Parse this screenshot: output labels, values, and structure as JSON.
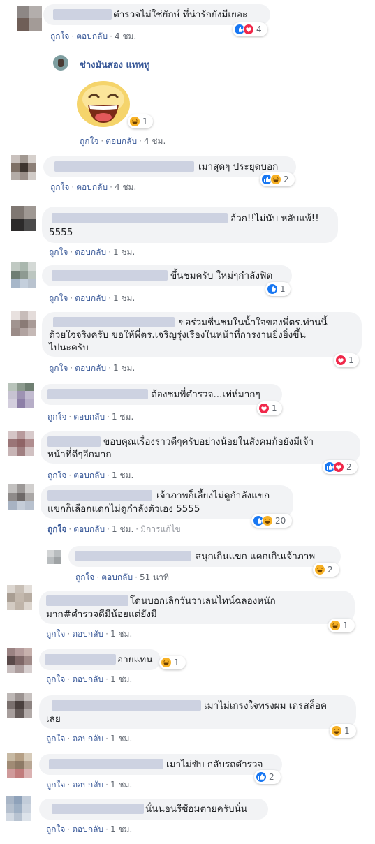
{
  "labels": {
    "like": "ถูกใจ",
    "reply": "ตอบกลับ",
    "edited": "มีการแก้ไข"
  },
  "comments": [
    {
      "text": "ตำรวจไม่ใช่ยักษ์ ที่น่ารักยังมีเยอะ",
      "time": "4 ชม.",
      "count": "4"
    },
    {
      "name": "ช่างมันสอง แทททู",
      "time": "4 ชม.",
      "count": "1"
    },
    {
      "text": "เมาสุดๆ ประยุดบอก",
      "time": "4 ชม.",
      "count": "2"
    },
    {
      "line1": "อ้วก!!ไม่นับ หลับแพ้!!",
      "line2": "5555",
      "time": "1 ชม."
    },
    {
      "text": "ขึ้นชมครับ ใหม่ๆกำลังฟิต",
      "time": "1 ชม.",
      "count": "1"
    },
    {
      "line1": "ขอร่วมชื่นชมในน้ำใจของพี่ตร.ท่านนี้",
      "line2": "ด้วยใจจริงครับ ขอให้พี่ตร.เจริญรุ่งเรืองในหน้าที่การงานยิ่งยิ่งขึ้น",
      "line3": "ไปนะครับ",
      "time": "1 ชม.",
      "count": "1"
    },
    {
      "text": "ต้องชมพี่ตำรวจ...เท่ห์มากๆ",
      "time": "1 ชม.",
      "count": "1"
    },
    {
      "line1": "ขอบคุณเรื่องราวดีๆครับอย่างน้อยในสังคมก้อยังมีเจ้า",
      "line2": "หน้าที่ดีๆอีกมาก",
      "time": "1 ชม.",
      "count": "2"
    },
    {
      "line1": "เจ้าภาพก็เลี้ยงไม่ดูกำลังแขก",
      "line2": "แขกก็เลือกแดกไม่ดูกำลังตัวเอง 5555",
      "time": "1 ชม.",
      "count": "20"
    },
    {
      "text": "สนุกเกินแขก แดกเกินเจ้าภาพ",
      "time": "51 นาที",
      "count": "2"
    },
    {
      "line1": "โดนบอกเลิกวันวาเลนไทน์ฉลองหนัก",
      "line2": "มาก#ตำรวจดีมีน้อยแต่ยังมี",
      "time": "1 ชม.",
      "count": "1"
    },
    {
      "text": "อายแทน",
      "time": "1 ชม.",
      "count": "1"
    },
    {
      "line1": "เมาไม่เกรงใจทรงผม เดรสล็อค",
      "line2": "เลย",
      "time": "1 ชม.",
      "count": "1"
    },
    {
      "text": "เมาไม่ขับ กลับรถตำรวจ",
      "time": "1 ชม.",
      "count": "2"
    },
    {
      "text": "นั่นนอนรีซ้อมตายครับนั่น",
      "time": "1 ชม."
    }
  ],
  "colors": {
    "link": "#385898",
    "meta": "#616770",
    "bubble": "#f2f3f5",
    "like": "#1877f2",
    "love": "#f0284a",
    "haha": "#f7b125"
  },
  "icons": [
    "like-icon",
    "love-icon",
    "haha-icon",
    "laughing-face-sticker"
  ]
}
